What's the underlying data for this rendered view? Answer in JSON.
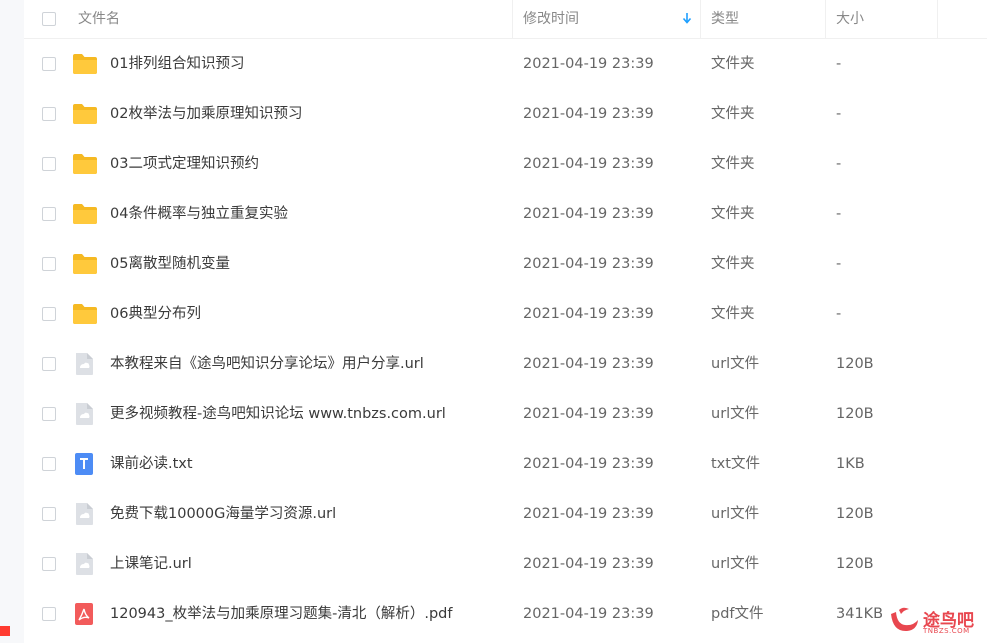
{
  "header": {
    "name_label": "文件名",
    "modified_label": "修改时间",
    "type_label": "类型",
    "size_label": "大小"
  },
  "files": [
    {
      "name": "01排列组合知识预习",
      "modified": "2021-04-19 23:39",
      "type": "文件夹",
      "size": "-",
      "icon": "folder-icon"
    },
    {
      "name": "02枚举法与加乘原理知识预习",
      "modified": "2021-04-19 23:39",
      "type": "文件夹",
      "size": "-",
      "icon": "folder-icon"
    },
    {
      "name": "03二项式定理知识预约",
      "modified": "2021-04-19 23:39",
      "type": "文件夹",
      "size": "-",
      "icon": "folder-icon"
    },
    {
      "name": "04条件概率与独立重复实验",
      "modified": "2021-04-19 23:39",
      "type": "文件夹",
      "size": "-",
      "icon": "folder-icon"
    },
    {
      "name": "05离散型随机变量",
      "modified": "2021-04-19 23:39",
      "type": "文件夹",
      "size": "-",
      "icon": "folder-icon"
    },
    {
      "name": "06典型分布列",
      "modified": "2021-04-19 23:39",
      "type": "文件夹",
      "size": "-",
      "icon": "folder-icon"
    },
    {
      "name": "本教程来自《途鸟吧知识分享论坛》用户分享.url",
      "modified": "2021-04-19 23:39",
      "type": "url文件",
      "size": "120B",
      "icon": "url-file-icon"
    },
    {
      "name": "更多视频教程-途鸟吧知识论坛 www.tnbzs.com.url",
      "modified": "2021-04-19 23:39",
      "type": "url文件",
      "size": "120B",
      "icon": "url-file-icon"
    },
    {
      "name": "课前必读.txt",
      "modified": "2021-04-19 23:39",
      "type": "txt文件",
      "size": "1KB",
      "icon": "txt-file-icon"
    },
    {
      "name": "免费下载10000G海量学习资源.url",
      "modified": "2021-04-19 23:39",
      "type": "url文件",
      "size": "120B",
      "icon": "url-file-icon"
    },
    {
      "name": "上课笔记.url",
      "modified": "2021-04-19 23:39",
      "type": "url文件",
      "size": "120B",
      "icon": "url-file-icon"
    },
    {
      "name": "120943_枚举法与加乘原理习题集-清北（解析）.pdf",
      "modified": "2021-04-19 23:39",
      "type": "pdf文件",
      "size": "341KB",
      "icon": "pdf-file-icon"
    }
  ],
  "sort": {
    "column": "modified",
    "direction": "down",
    "icon": "sort-down-arrow-icon"
  },
  "watermark": {
    "logo_text": "途鸟吧",
    "sub_text": "TNBZS.COM",
    "icon": "tnbzs-logo-icon"
  },
  "colors": {
    "folder": "#FFC93C",
    "folder_tab": "#F5B922",
    "url_file": "#DDE0E5",
    "txt_file": "#4D8CF5",
    "pdf_file": "#F25B5B",
    "sort_arrow": "#1E9FFF",
    "watermark": "#E8474F"
  }
}
